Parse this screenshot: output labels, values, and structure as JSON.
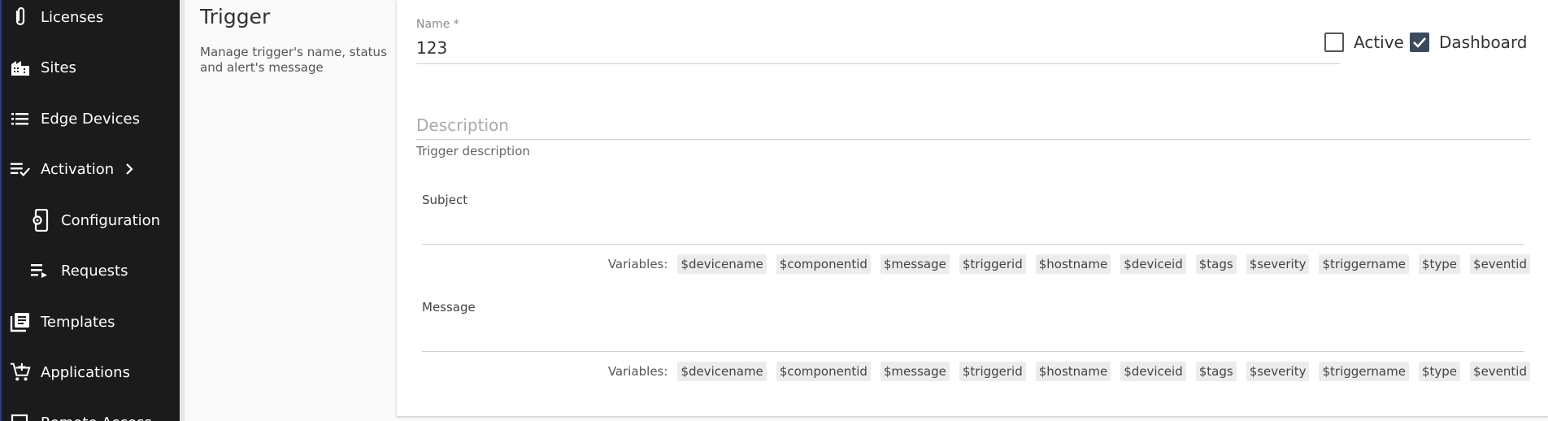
{
  "sidebar": {
    "items": [
      {
        "label": "Licenses",
        "icon": "paperclip-icon"
      },
      {
        "label": "Sites",
        "icon": "buildings-icon"
      },
      {
        "label": "Edge Devices",
        "icon": "list-icon"
      },
      {
        "label": "Activation",
        "icon": "checklist-icon"
      },
      {
        "label": "Configuration",
        "icon": "phone-settings-icon"
      },
      {
        "label": "Requests",
        "icon": "queue-icon"
      },
      {
        "label": "Templates",
        "icon": "library-books-icon"
      },
      {
        "label": "Applications",
        "icon": "add-cart-icon"
      },
      {
        "label": "Remote Access",
        "icon": "computer-icon"
      }
    ]
  },
  "section": {
    "title": "Trigger",
    "description": "Manage trigger's name, status and alert's message"
  },
  "form": {
    "name_label": "Name *",
    "name_value": "123",
    "active_label": "Active",
    "active_checked": false,
    "dashboard_label": "Dashboard",
    "dashboard_checked": true,
    "description_placeholder": "Description",
    "description_hint": "Trigger description",
    "subject_label": "Subject",
    "message_label": "Message",
    "variables_label": "Variables:",
    "variables": [
      "$devicename",
      "$componentid",
      "$message",
      "$triggerid",
      "$hostname",
      "$deviceid",
      "$tags",
      "$severity",
      "$triggername",
      "$type",
      "$eventid"
    ]
  },
  "colors": {
    "sidebar_bg": "#1b1b1b",
    "checkbox_checked": "#3b4a5d"
  }
}
